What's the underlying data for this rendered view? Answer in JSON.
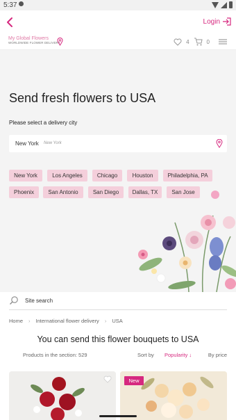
{
  "status_bar": {
    "time": "5:37"
  },
  "topbar": {
    "login_label": "Login"
  },
  "header": {
    "logo_line1": "My Global Flowers",
    "logo_line2": "WORLDWIDE FLOWER DELIVERY",
    "favorites_count": "4",
    "cart_count": "0"
  },
  "hero": {
    "title": "Send fresh flowers to USA",
    "subtitle": "Please select a delivery city",
    "city_value": "New York",
    "city_placeholder": "New York",
    "cities": [
      "New York",
      "Los Angeles",
      "Chicago",
      "Houston",
      "Philadelphia, PA",
      "Phoenix",
      "San Antonio",
      "San Diego",
      "Dallas, TX",
      "San Jose"
    ]
  },
  "search": {
    "label": "Site search"
  },
  "breadcrumb": [
    "Home",
    "International flower delivery",
    "USA"
  ],
  "catalog": {
    "heading": "You can send this flower bouquets to USA",
    "products_count": "Products in the section: 529",
    "sort_by": "Sort by",
    "sort_value": "Popularity ↓",
    "by_price": "By price",
    "badge_new": "New"
  },
  "colors": {
    "accent": "#d6287f",
    "chip": "#f4cfdb",
    "hero_bg": "#f4f4f4"
  }
}
